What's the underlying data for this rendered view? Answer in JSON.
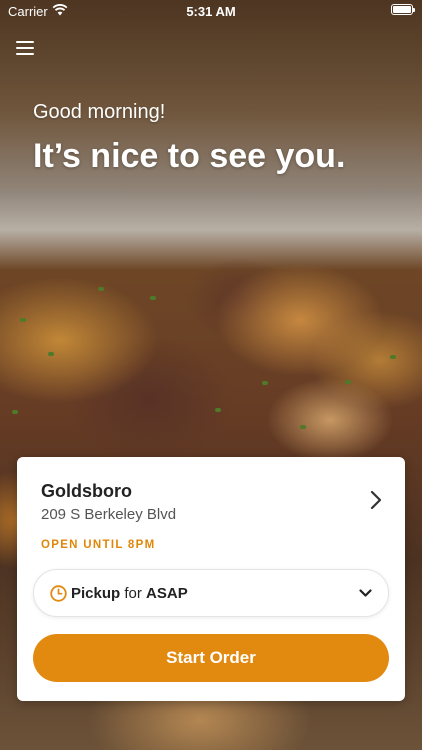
{
  "status_bar": {
    "carrier": "Carrier",
    "time": "5:31 AM"
  },
  "header": {
    "menu_icon": "hamburger-menu-icon"
  },
  "greeting": {
    "line1": "Good morning!",
    "line2": "It’s nice to see you."
  },
  "store": {
    "name": "Goldsboro",
    "address": "209 S Berkeley Blvd",
    "hours": "OPEN UNTIL 8PM"
  },
  "order": {
    "mode": "Pickup",
    "connector": "for",
    "time": "ASAP",
    "button_label": "Start Order"
  },
  "colors": {
    "accent": "#e28a10",
    "hours_text": "#e0870a"
  },
  "icons": {
    "wifi": "wifi-icon",
    "battery": "battery-icon",
    "clock": "clock-icon",
    "chevron_right": "chevron-right-icon",
    "chevron_down": "chevron-down-icon"
  }
}
